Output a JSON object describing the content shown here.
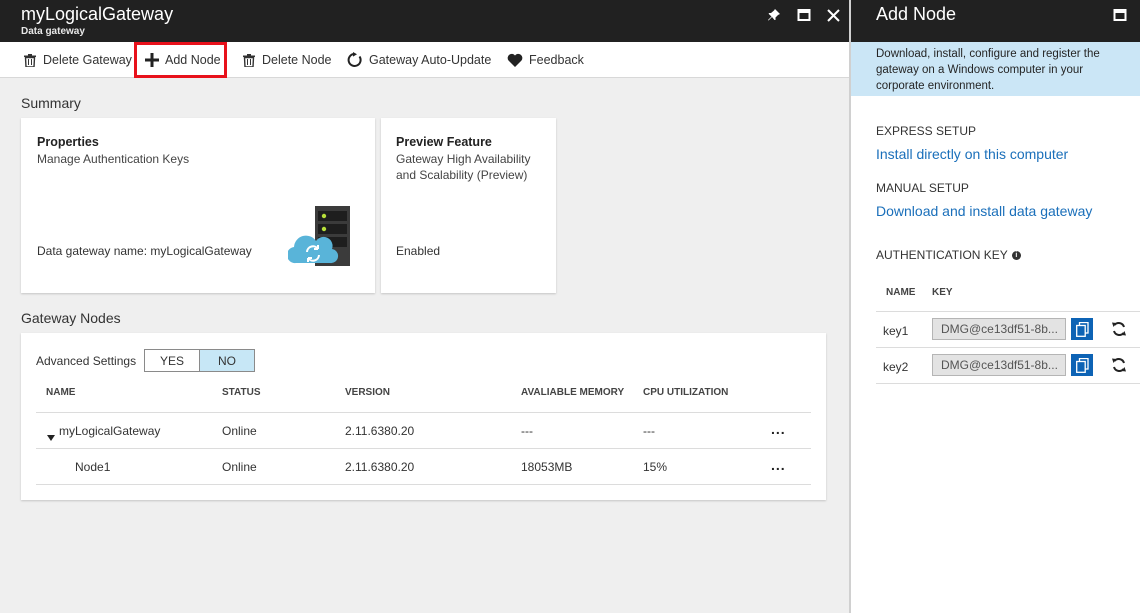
{
  "left_blade": {
    "title": "myLogicalGateway",
    "subtitle": "Data gateway",
    "toolbar": {
      "delete_gateway": "Delete Gateway",
      "add_node": "Add Node",
      "delete_node": "Delete Node",
      "auto_update": "Gateway Auto-Update",
      "feedback": "Feedback"
    },
    "summary": {
      "section_title": "Summary",
      "properties_card": {
        "title": "Properties",
        "subtitle": "Manage Authentication Keys",
        "footer": "Data gateway name: myLogicalGateway"
      },
      "preview_card": {
        "title": "Preview Feature",
        "subtitle": "Gateway High Availability and Scalability (Preview)",
        "footer": "Enabled"
      }
    },
    "nodes": {
      "section_title": "Gateway Nodes",
      "advanced_settings_label": "Advanced Settings",
      "toggle_yes": "YES",
      "toggle_no": "NO",
      "headers": {
        "name": "NAME",
        "status": "STATUS",
        "version": "VERSION",
        "memory": "AVALIABLE MEMORY",
        "cpu": "CPU UTILIZATION"
      },
      "rows": [
        {
          "name": "myLogicalGateway",
          "status": "Online",
          "version": "2.11.6380.20",
          "memory": "---",
          "cpu": "---",
          "more": "..."
        },
        {
          "name": "Node1",
          "status": "Online",
          "version": "2.11.6380.20",
          "memory": "18053MB",
          "cpu": "15%",
          "more": "..."
        }
      ]
    }
  },
  "right_blade": {
    "title": "Add Node",
    "info": "Download, install, configure and register the gateway on a Windows computer in your corporate environment.",
    "express_label": "EXPRESS SETUP",
    "express_link": "Install directly on this computer",
    "manual_label": "MANUAL SETUP",
    "manual_link": "Download and install data gateway",
    "auth_label": "AUTHENTICATION KEY",
    "key_headers": {
      "name": "NAME",
      "key": "KEY"
    },
    "keys": [
      {
        "name": "key1",
        "value": "DMG@ce13df51-8b..."
      },
      {
        "name": "key2",
        "value": "DMG@ce13df51-8b..."
      }
    ]
  },
  "colors": {
    "titlebar": "#212121",
    "accent_blue": "#0d63b5",
    "link_blue": "#1a6fba",
    "info_bg": "#cbe6f6",
    "highlight_red": "#e8111b",
    "toggle_selected": "#c7e7f6"
  }
}
